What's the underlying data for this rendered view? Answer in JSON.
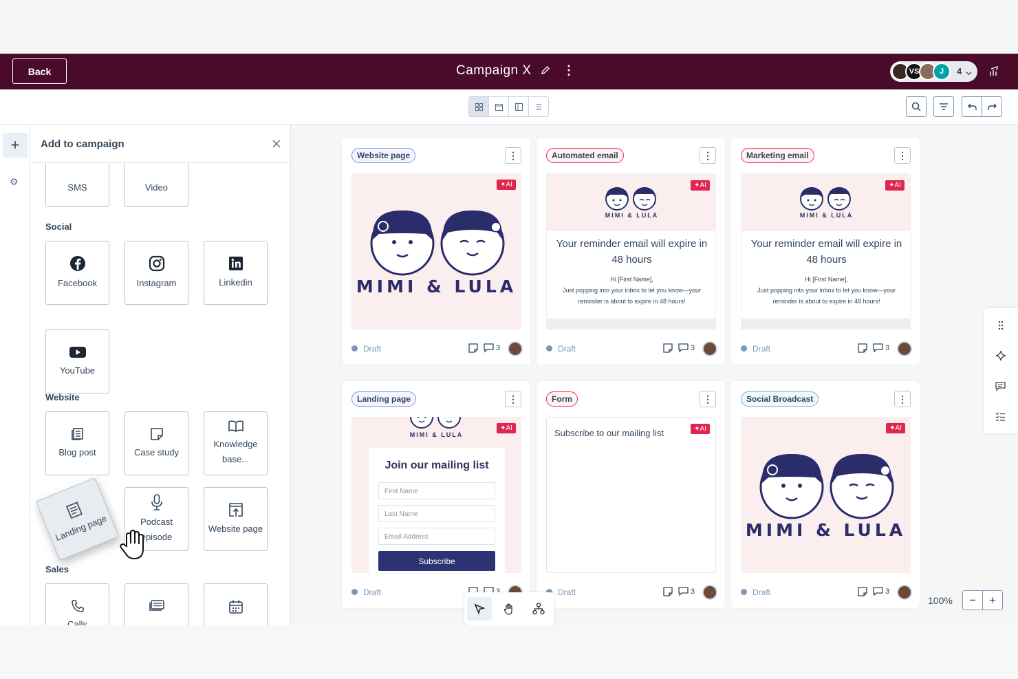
{
  "header": {
    "back_label": "Back",
    "campaign_title": "Campaign X",
    "avatars": [
      {
        "initials": "",
        "color": "#3a2a24"
      },
      {
        "initials": "VS",
        "color": "#111111"
      },
      {
        "initials": "",
        "color": "#8a6a5a"
      },
      {
        "initials": "J",
        "color": "#00a4a6"
      }
    ],
    "collaborator_count": "4"
  },
  "panel": {
    "title": "Add to campaign",
    "top_tiles": [
      "SMS",
      "Video"
    ],
    "social_label": "Social",
    "social_tiles": [
      "Facebook",
      "Instagram",
      "Linkedin",
      "YouTube"
    ],
    "website_label": "Website",
    "website_tiles": [
      "Blog post",
      "Case study",
      "Knowledge base...",
      "Landing page",
      "Podcast episode",
      "Website page"
    ],
    "sales_label": "Sales",
    "sales_tiles": [
      "Calls",
      "",
      ""
    ]
  },
  "cards": [
    {
      "tag": "Website page",
      "status": "Draft",
      "comments": "3",
      "ai": "✦AI"
    },
    {
      "tag": "Automated email",
      "status": "Draft",
      "comments": "3",
      "ai": "✦AI",
      "brand": "MIMI & LULA",
      "headline": "Your reminder email will expire in 48 hours",
      "body1": "Hi [First Name],",
      "body2": "Just popping into your inbox to let you know—your reminder is about to expire in 48 hours!"
    },
    {
      "tag": "Marketing email",
      "status": "Draft",
      "comments": "3",
      "ai": "✦AI",
      "brand": "MIMI & LULA",
      "headline": "Your reminder email will expire in 48 hours",
      "body1": "Hi [First Name],",
      "body2": "Just popping into your inbox to let you know—your reminder is about to expire in 48 hours!"
    },
    {
      "tag": "Landing page",
      "status": "Draft",
      "comments": "3",
      "ai": "✦AI",
      "brand": "MIMI & LULA",
      "form_title": "Join our mailing list",
      "fields": [
        "First Name",
        "Last Name",
        "Email Address"
      ],
      "button": "Subscribe"
    },
    {
      "tag": "Form",
      "status": "Draft",
      "comments": "3",
      "ai": "✦AI",
      "form_text": "Subscribe to our mailing list"
    },
    {
      "tag": "Social Broadcast",
      "status": "Draft",
      "comments": "3",
      "ai": "✦AI"
    }
  ],
  "logo_text": "MIMI & LULA",
  "zoom": {
    "label": "100%",
    "minus": "−",
    "plus": "+"
  },
  "colors": {
    "header_bg": "#4a0a2a",
    "ai_badge": "#e0254e",
    "tag_purple": "#8b8fe8",
    "tag_red": "#e0324c",
    "tag_blue": "#6fb3d8",
    "subscribe_button": "#2d3372"
  }
}
